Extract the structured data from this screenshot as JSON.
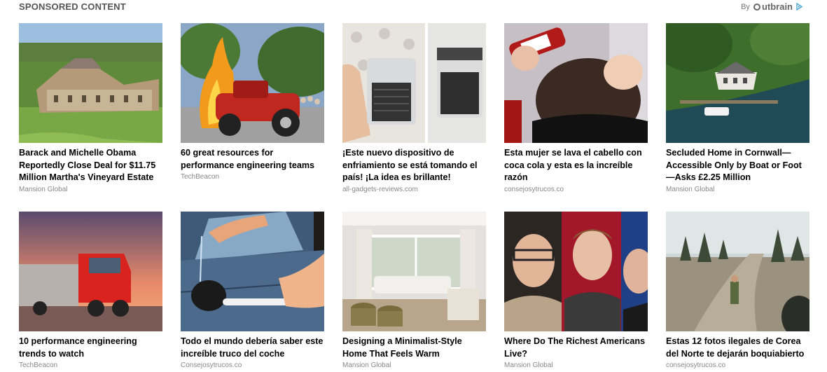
{
  "header": {
    "title": "SPONSORED CONTENT",
    "by_label": "By",
    "brand": "utbrain"
  },
  "cards": [
    {
      "title": "Barack and Michelle Obama Reportedly Close Deal for $11.75 Million Martha's Vineyard Estate",
      "source": "Mansion Global",
      "image": "mansion-estate-image"
    },
    {
      "title": "60 great resources for performance engineering teams",
      "source": "TechBeacon",
      "image": "hot-rod-fire-image"
    },
    {
      "title": "¡Este nuevo dispositivo de enfriamiento se está tomando el país! ¡La idea es brillante!",
      "source": "all-gadgets-reviews.com",
      "image": "cooling-device-image"
    },
    {
      "title": "Esta mujer se lava el cabello con coca cola y esta es la increíble razón",
      "source": "consejosytrucos.co",
      "image": "hair-cola-image"
    },
    {
      "title": "Secluded Home in Cornwall—Accessible Only by Boat or Foot—Asks £2.25 Million",
      "source": "Mansion Global",
      "image": "lakeside-home-image"
    },
    {
      "title": "10 performance engineering trends to watch",
      "source": "TechBeacon",
      "image": "red-truck-image"
    },
    {
      "title": "Todo el mundo debería saber este increíble truco del coche",
      "source": "Consejosytrucos.co",
      "image": "car-plunger-image"
    },
    {
      "title": "Designing a Minimalist-Style Home That Feels Warm",
      "source": "Mansion Global",
      "image": "living-room-image"
    },
    {
      "title": "Where Do The Richest Americans Live?",
      "source": "Mansion Global",
      "image": "billionaires-image"
    },
    {
      "title": "Estas 12 fotos ilegales de Corea del Norte te dejarán boquiabierto",
      "source": "consejosytrucos.co",
      "image": "north-korea-image"
    }
  ]
}
